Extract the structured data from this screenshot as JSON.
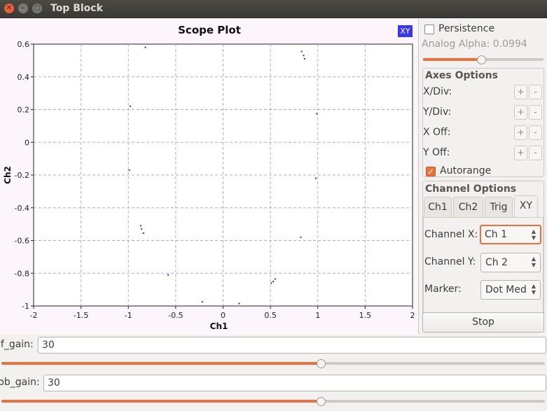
{
  "window": {
    "title": "Top Block"
  },
  "plot": {
    "title": "Scope Plot",
    "xy_badge": "XY"
  },
  "chart_data": {
    "type": "scatter",
    "title": "Scope Plot",
    "xlabel": "Ch1",
    "ylabel": "Ch2",
    "xlim": [
      -2,
      2
    ],
    "ylim": [
      -1,
      0.6
    ],
    "xticks": [
      -2,
      -1.5,
      -1,
      -0.5,
      0,
      0.5,
      1,
      1.5,
      2
    ],
    "xtick_labels": [
      "-2",
      "-1.5",
      "-1",
      "-0.5",
      "0",
      "0.5",
      "1",
      "1.5",
      "2"
    ],
    "yticks": [
      0.6,
      0.4,
      0.2,
      0,
      -0.2,
      -0.4,
      -0.6,
      -0.8,
      -1
    ],
    "ytick_labels": [
      "0.6",
      "0.4",
      "0.2",
      "0",
      "-0.2",
      "-0.4",
      "-0.6",
      "-0.8",
      "-1"
    ],
    "grid": true,
    "point_color": "#2a2ad8",
    "points": [
      [
        -0.82,
        0.58
      ],
      [
        0.83,
        0.555
      ],
      [
        0.85,
        0.53
      ],
      [
        0.86,
        0.51
      ],
      [
        -0.98,
        0.22
      ],
      [
        0.99,
        0.175
      ],
      [
        -0.99,
        -0.17
      ],
      [
        0.98,
        -0.22
      ],
      [
        -0.87,
        -0.51
      ],
      [
        -0.86,
        -0.53
      ],
      [
        -0.84,
        -0.555
      ],
      [
        0.82,
        -0.58
      ],
      [
        -0.58,
        -0.81
      ],
      [
        0.51,
        -0.86
      ],
      [
        0.53,
        -0.85
      ],
      [
        0.55,
        -0.835
      ],
      [
        -0.22,
        -0.975
      ],
      [
        0.17,
        -0.985
      ]
    ]
  },
  "sidebar": {
    "persistence_label": "Persistence",
    "persistence_checked": false,
    "analog_alpha_label": "Analog Alpha: 0.0994",
    "analog_alpha_fraction": 0.48,
    "axes_options_title": "Axes Options",
    "axes": [
      {
        "label": "X/Div:",
        "plus": "+",
        "minus": "-"
      },
      {
        "label": "Y/Div:",
        "plus": "+",
        "minus": "-"
      },
      {
        "label": "X Off:",
        "plus": "+",
        "minus": "-"
      },
      {
        "label": "Y Off:",
        "plus": "+",
        "minus": "-"
      }
    ],
    "autorange_label": "Autorange",
    "autorange_checked": true,
    "channel_options_title": "Channel Options",
    "tabs": [
      {
        "label": "Ch1"
      },
      {
        "label": "Ch2"
      },
      {
        "label": "Trig"
      },
      {
        "label": "XY",
        "active": true
      }
    ],
    "channel_x_label": "Channel X:",
    "channel_x_value": "Ch 1",
    "channel_y_label": "Channel Y:",
    "channel_y_value": "Ch 2",
    "marker_label": "Marker:",
    "marker_value": "Dot Med",
    "stop_label": "Stop"
  },
  "gains": {
    "if_gain_label": "if_gain:",
    "if_gain_value": "30",
    "if_gain_fraction": 0.587,
    "bb_gain_label": "bb_gain:",
    "bb_gain_value": "30",
    "bb_gain_fraction": 0.587
  },
  "colors": {
    "accent": "#e9703f",
    "plot_background": "#fcf5fc",
    "xy_badge": "#3838e8"
  }
}
